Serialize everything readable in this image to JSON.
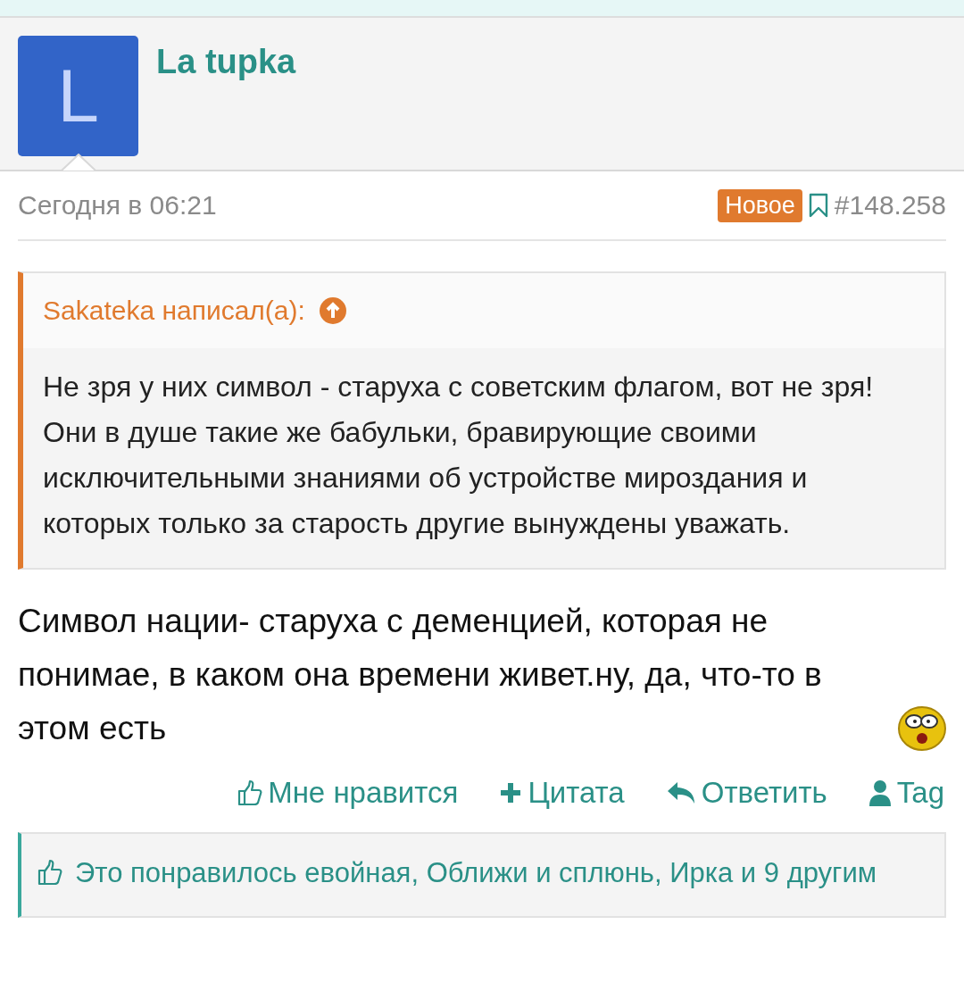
{
  "author": {
    "name": "La tupka",
    "avatar_letter": "L"
  },
  "meta": {
    "date": "Сегодня в 06:21",
    "badge": "Новое",
    "post_number": "#148.258"
  },
  "quote": {
    "author": "Sakateka написал(а):",
    "text": "Не зря у них символ - старуха с советским флагом, вот не зря! Они в душе такие же бабульки, бравирующие своими исключительными знаниями об устройстве мироздания и которых только за старость другие вынуждены уважать."
  },
  "message": "Символ нации- старуха с деменцией, которая не понимае, в каком она времени живет.ну, да, что-то в этом есть",
  "actions": [
    {
      "kind": "like",
      "label": "Мне нравится"
    },
    {
      "kind": "quote",
      "label": "Цитата"
    },
    {
      "kind": "reply",
      "label": "Ответить"
    },
    {
      "kind": "tag",
      "label": "Tag"
    }
  ],
  "likes": "Это понравилось евойная, Оближи и сплюнь, Ирка и 9 другим"
}
